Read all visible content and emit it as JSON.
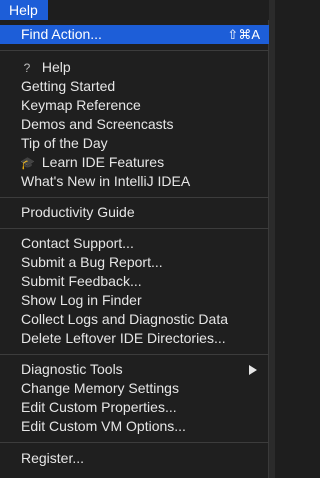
{
  "menubar": {
    "title": "Help"
  },
  "menu": {
    "find_action": {
      "label": "Find Action...",
      "shortcut": "⇧⌘A"
    },
    "help": {
      "label": "Help",
      "icon_glyph": "?"
    },
    "getting_started": "Getting Started",
    "keymap_reference": "Keymap Reference",
    "demos": "Demos and Screencasts",
    "tip_of_day": "Tip of the Day",
    "learn_ide": {
      "label": "Learn IDE Features",
      "icon_glyph": "🎓"
    },
    "whats_new": "What's New in IntelliJ IDEA",
    "productivity_guide": "Productivity Guide",
    "contact_support": "Contact Support...",
    "submit_bug": "Submit a Bug Report...",
    "submit_feedback": "Submit Feedback...",
    "show_log": "Show Log in Finder",
    "collect_logs": "Collect Logs and Diagnostic Data",
    "delete_leftover": "Delete Leftover IDE Directories...",
    "diagnostic_tools": "Diagnostic Tools",
    "change_memory": "Change Memory Settings",
    "edit_properties": "Edit Custom Properties...",
    "edit_vm_options": "Edit Custom VM Options...",
    "register": "Register..."
  },
  "colors": {
    "accent": "#1d5ed8",
    "menu_bg": "#1f1f1f",
    "text": "#e6e6e6"
  }
}
